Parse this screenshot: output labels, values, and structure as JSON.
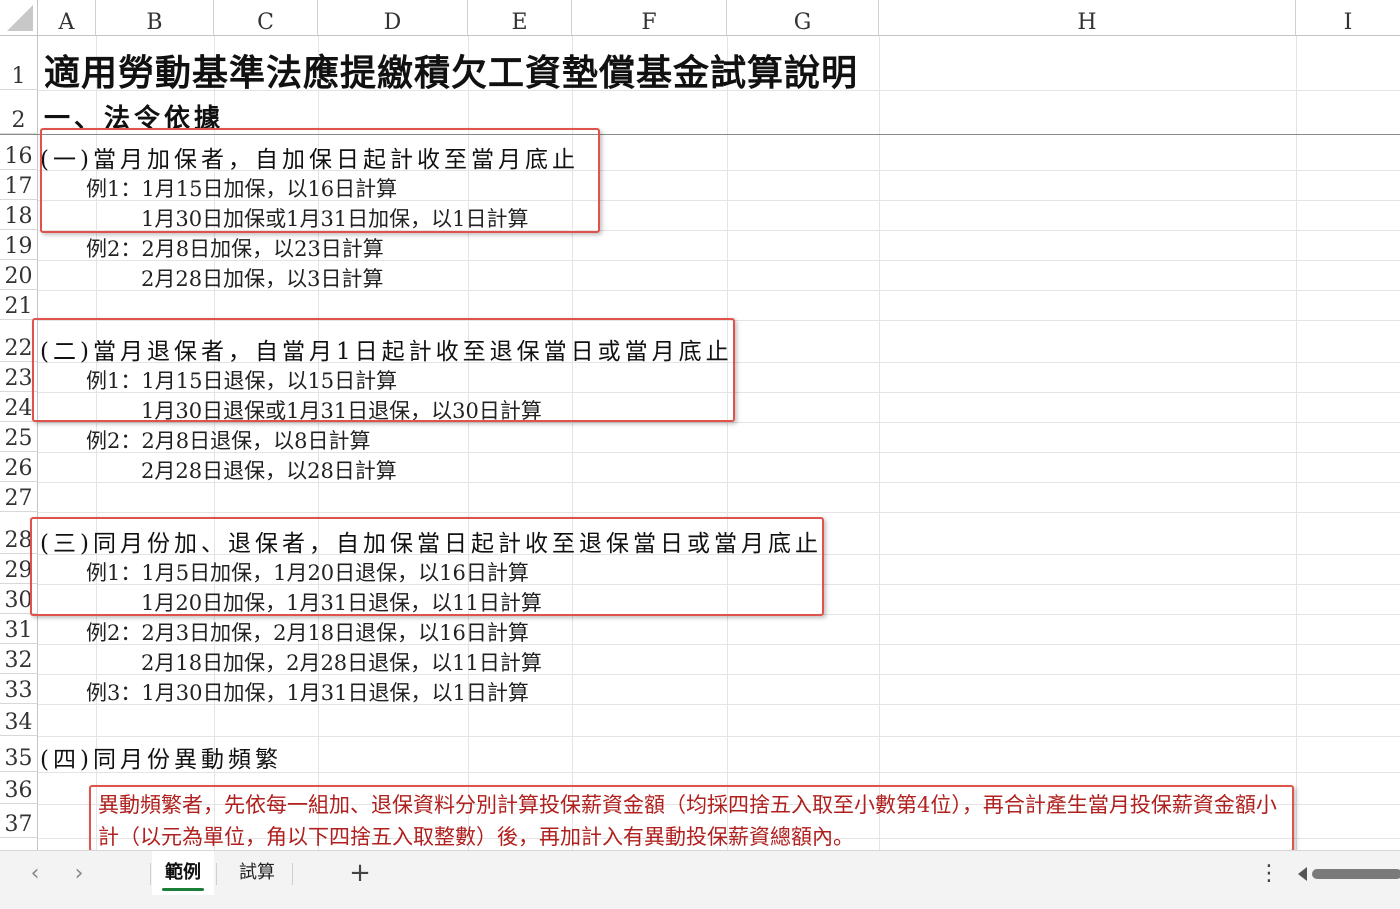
{
  "columns": [
    "A",
    "B",
    "C",
    "D",
    "E",
    "F",
    "G",
    "H",
    "I"
  ],
  "rows": [
    "1",
    "2",
    "16",
    "17",
    "18",
    "19",
    "20",
    "21",
    "22",
    "23",
    "24",
    "25",
    "26",
    "27",
    "28",
    "29",
    "30",
    "31",
    "32",
    "33",
    "34",
    "35",
    "36",
    "37"
  ],
  "content": {
    "title": "適用勞動基準法應提繳積欠工資墊償基金試算說明",
    "section_basis": "一、法令依據",
    "sec1": {
      "heading": "(一)當月加保者，自加保日起計收至當月底止",
      "l1": "例1：1月15日加保，以16日計算",
      "l2": "1月30日加保或1月31日加保，以1日計算",
      "l3": "例2：2月8日加保，以23日計算",
      "l4": "2月28日加保，以3日計算"
    },
    "sec2": {
      "heading": "(二)當月退保者，自當月1日起計收至退保當日或當月底止",
      "l1": "例1：1月15日退保，以15日計算",
      "l2": "1月30日退保或1月31日退保，以30日計算",
      "l3": "例2：2月8日退保，以8日計算",
      "l4": "2月28日退保，以28日計算"
    },
    "sec3": {
      "heading": "(三)同月份加、退保者，自加保當日起計收至退保當日或當月底止",
      "l1": "例1：1月5日加保，1月20日退保，以16日計算",
      "l2": "1月20日加保，1月31日退保，以11日計算",
      "l3": "例2：2月3日加保，2月18日退保，以16日計算",
      "l4": "2月18日加保，2月28日退保，以11日計算",
      "l5": "例3：1月30日加保，1月31日退保，以1日計算"
    },
    "sec4": {
      "heading": "(四)同月份異動頻繁",
      "note": "異動頻繁者，先依每一組加、退保資料分別計算投保薪資金額（均採四捨五入取至小數第4位），再合計產生當月投保薪資金額小計（以元為單位，角以下四捨五入取整數）後，再加計入有異動投保薪資總額內。"
    }
  },
  "tabs": [
    {
      "label": "範例",
      "active": true
    },
    {
      "label": "試算",
      "active": false
    }
  ],
  "icons": {
    "prev": "‹",
    "next": "›",
    "add": "+",
    "more": "⋮"
  },
  "colors": {
    "highlight_box": "#e0534c",
    "note_text": "#b0201e",
    "active_tab_underline": "#1b7f3a"
  }
}
